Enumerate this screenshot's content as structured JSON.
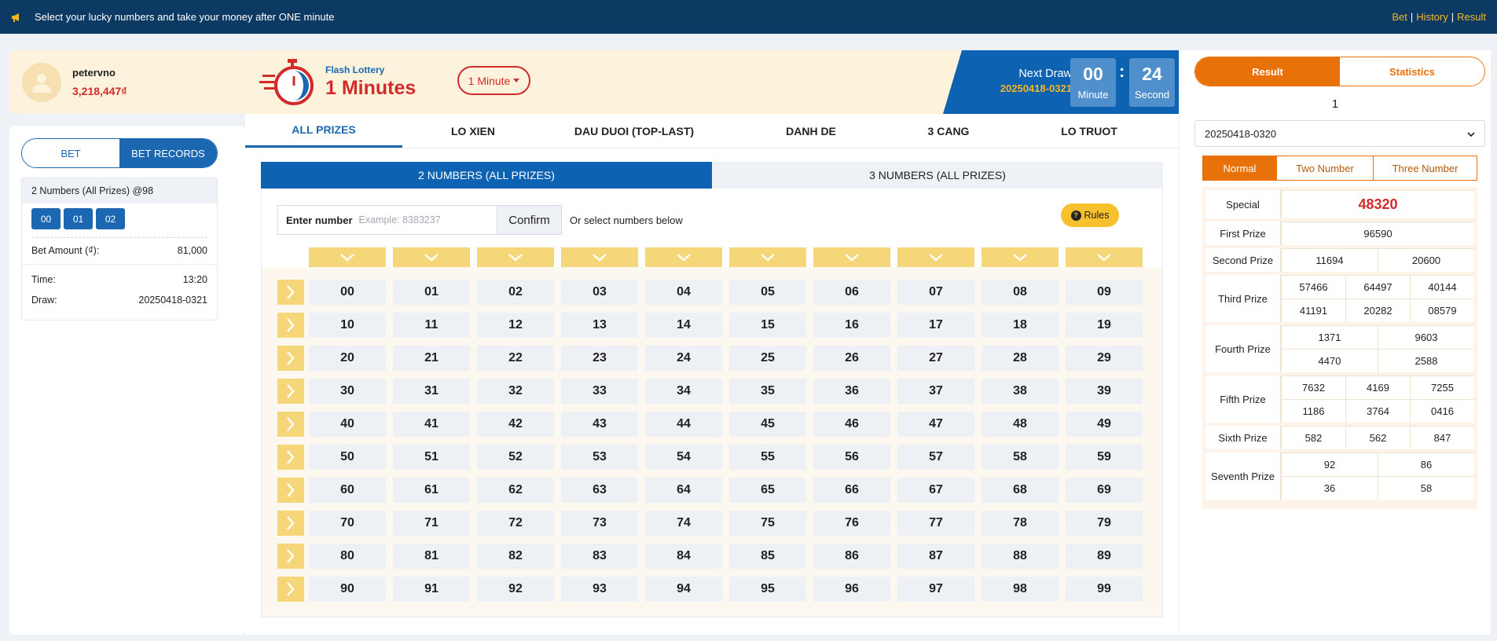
{
  "topbar": {
    "announcement": "Select your lucky numbers and take your money after ONE minute",
    "links": [
      "Bet",
      "History",
      "Result"
    ],
    "accent": "#f3b723"
  },
  "user": {
    "name": "petervno",
    "balance": "3,218,447₫"
  },
  "left_tabs": {
    "bet": "BET",
    "records": "BET RECORDS"
  },
  "record": {
    "title": "2 Numbers (All Prizes) @98",
    "numbers": [
      "00",
      "01",
      "02"
    ],
    "bet_amount_label": "Bet Amount (₫):",
    "bet_amount": "81,000",
    "time_label": "Time:",
    "time": "13:20",
    "draw_label": "Draw:",
    "draw": "20250418-0321"
  },
  "header": {
    "brand_small": "Flash Lottery",
    "brand_big": "1 Minutes",
    "dropdown": "1 Minute",
    "next_draw_label": "Next Draw",
    "next_draw_id": "20250418-0321",
    "minute": "00",
    "minute_label": "Minute",
    "second": "24",
    "second_label": "Second",
    "colon": ":"
  },
  "prize_tabs": [
    "ALL PRIZES",
    "LO XIEN",
    "DAU DUOI (TOP-LAST)",
    "DANH DE",
    "3 CANG",
    "LO TRUOT"
  ],
  "subtabs": [
    "2 NUMBERS (ALL PRIZES)",
    "3 NUMBERS (ALL PRIZES)"
  ],
  "input": {
    "label": "Enter number",
    "placeholder": "Example: 8383237",
    "confirm": "Confirm",
    "or_select": "Or select numbers below",
    "rules": "Rules"
  },
  "numbers": [
    [
      "00",
      "01",
      "02",
      "03",
      "04",
      "05",
      "06",
      "07",
      "08",
      "09"
    ],
    [
      "10",
      "11",
      "12",
      "13",
      "14",
      "15",
      "16",
      "17",
      "18",
      "19"
    ],
    [
      "20",
      "21",
      "22",
      "23",
      "24",
      "25",
      "26",
      "27",
      "28",
      "29"
    ],
    [
      "30",
      "31",
      "32",
      "33",
      "34",
      "35",
      "36",
      "37",
      "38",
      "39"
    ],
    [
      "40",
      "41",
      "42",
      "43",
      "44",
      "45",
      "46",
      "47",
      "48",
      "49"
    ],
    [
      "50",
      "51",
      "52",
      "53",
      "54",
      "55",
      "56",
      "57",
      "58",
      "59"
    ],
    [
      "60",
      "61",
      "62",
      "63",
      "64",
      "65",
      "66",
      "67",
      "68",
      "69"
    ],
    [
      "70",
      "71",
      "72",
      "73",
      "74",
      "75",
      "76",
      "77",
      "78",
      "79"
    ],
    [
      "80",
      "81",
      "82",
      "83",
      "84",
      "85",
      "86",
      "87",
      "88",
      "89"
    ],
    [
      "90",
      "91",
      "92",
      "93",
      "94",
      "95",
      "96",
      "97",
      "98",
      "99"
    ]
  ],
  "right": {
    "tab_result": "Result",
    "tab_statistics": "Statistics",
    "page": "1",
    "draw_select": "20250418-0320",
    "modes": [
      "Normal",
      "Two Number",
      "Three Number"
    ],
    "prizes": [
      {
        "label": "Special",
        "values": [
          "48320"
        ],
        "cols": 1,
        "special": true
      },
      {
        "label": "First Prize",
        "values": [
          "96590"
        ],
        "cols": 1
      },
      {
        "label": "Second Prize",
        "values": [
          "11694",
          "20600"
        ],
        "cols": 2
      },
      {
        "label": "Third Prize",
        "values": [
          "57466",
          "64497",
          "40144",
          "41191",
          "20282",
          "08579"
        ],
        "cols": 3
      },
      {
        "label": "Fourth Prize",
        "values": [
          "1371",
          "9603",
          "4470",
          "2588"
        ],
        "cols": 2
      },
      {
        "label": "Fifth Prize",
        "values": [
          "7632",
          "4169",
          "7255",
          "1186",
          "3764",
          "0416"
        ],
        "cols": 3
      },
      {
        "label": "Sixth Prize",
        "values": [
          "582",
          "562",
          "847"
        ],
        "cols": 3
      },
      {
        "label": "Seventh Prize",
        "values": [
          "92",
          "86",
          "36",
          "58"
        ],
        "cols": 2
      }
    ]
  },
  "colors": {
    "navy": "#0d3a63",
    "blue": "#1b67b1",
    "red": "#d22b2b",
    "orange": "#e8710a",
    "yellow": "#f5d77a"
  }
}
